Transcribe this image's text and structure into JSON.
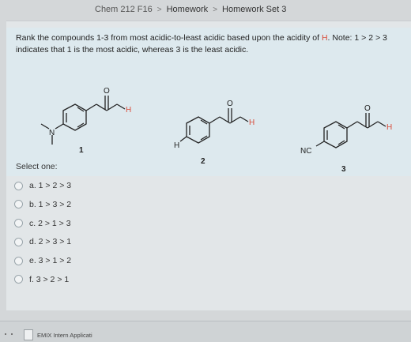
{
  "breadcrumb": {
    "items": [
      "Chem 212 F16",
      "Homework",
      "Homework Set 3"
    ],
    "separator": ">"
  },
  "question": {
    "text_before": "Rank the compounds 1-3 from most acidic-to-least acidic based upon the acidity of ",
    "highlight": "H",
    "text_after": ". Note: 1 > 2 > 3 indicates that 1 is the most acidic, whereas 3 is the least acidic.",
    "highlight_color": "#d94c3a"
  },
  "molecules": [
    {
      "number": "1",
      "substituent": "N",
      "o_label": "O",
      "h_label": "H"
    },
    {
      "number": "2",
      "substituent": "H",
      "o_label": "O",
      "h_label": "H"
    },
    {
      "number": "3",
      "substituent": "NC",
      "o_label": "O",
      "h_label": "H"
    }
  ],
  "select_label": "Select one:",
  "options": [
    "a. 1 > 2 > 3",
    "b. 1 > 3 > 2",
    "c. 2 > 1 > 3",
    "d. 2 > 3 > 1",
    "e. 3 > 1 > 2",
    "f. 3 > 2 > 1"
  ],
  "taskbar": {
    "item_label": "EMIX Intern Applicati"
  }
}
